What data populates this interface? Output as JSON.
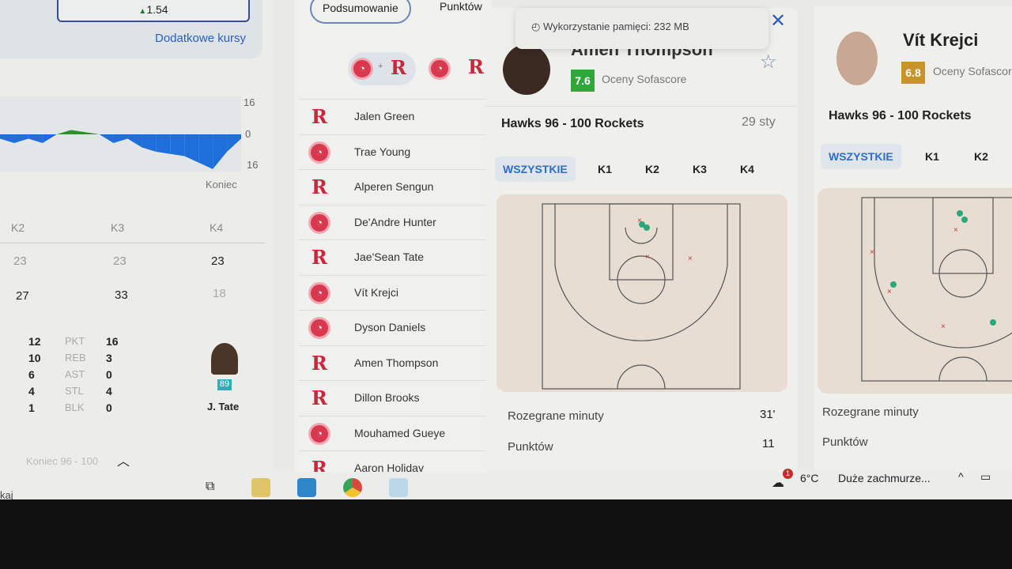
{
  "left": {
    "odds_value": "1.54",
    "more_odds": "Dodatkowe kursy",
    "chart_data": {
      "type": "area",
      "title": "",
      "y_ticks": [
        "16",
        "0",
        "16"
      ],
      "x_label_end": "Koniec",
      "ylim": [
        -16,
        16
      ],
      "values": [
        -2,
        -4,
        -2,
        -4,
        0,
        2,
        1,
        0,
        -4,
        -2,
        -6,
        -8,
        -9,
        -10,
        -13,
        -16,
        -8,
        -2
      ]
    },
    "quarters": {
      "headers": [
        "K2",
        "K3",
        "K4"
      ],
      "row1": [
        "23",
        "23",
        "23"
      ],
      "row2": [
        "27",
        "33",
        "18"
      ]
    },
    "stats": [
      {
        "l": "12",
        "label": "PKT",
        "r": "16"
      },
      {
        "l": "10",
        "label": "REB",
        "r": "3"
      },
      {
        "l": "6",
        "label": "AST",
        "r": "0"
      },
      {
        "l": "4",
        "label": "STL",
        "r": "4"
      },
      {
        "l": "1",
        "label": "BLK",
        "r": "0"
      }
    ],
    "player_name": "J. Tate",
    "jersey": "89",
    "footer": "Koniec 96 - 100",
    "search_fragment": "kaj"
  },
  "middle": {
    "tabs": [
      "Podsumowanie",
      "Punktów"
    ],
    "plus": "+",
    "players": [
      {
        "name": "Jalen Green",
        "team": "rockets"
      },
      {
        "name": "Trae Young",
        "team": "hawks"
      },
      {
        "name": "Alperen Sengun",
        "team": "rockets"
      },
      {
        "name": "De'Andre Hunter",
        "team": "hawks"
      },
      {
        "name": "Jae'Sean Tate",
        "team": "rockets"
      },
      {
        "name": "Vít Krejci",
        "team": "hawks"
      },
      {
        "name": "Dyson Daniels",
        "team": "hawks"
      },
      {
        "name": "Amen Thompson",
        "team": "rockets"
      },
      {
        "name": "Dillon Brooks",
        "team": "rockets"
      },
      {
        "name": "Mouhamed Gueye",
        "team": "hawks"
      },
      {
        "name": "Aaron Holiday",
        "team": "rockets"
      }
    ]
  },
  "memory_tip": "Wykorzystanie pamięci: 232 MB",
  "popup1": {
    "name": "Amen Thompson",
    "rating": "7.6",
    "rating_color": "#2fa83a",
    "rating_label": "Oceny Sofascore",
    "match": "Hawks 96 - 100 Rockets",
    "date": "29 sty",
    "tabs": [
      "WSZYSTKIE",
      "K1",
      "K2",
      "K3",
      "K4"
    ],
    "stats": [
      {
        "label": "Rozegrane minuty",
        "value": "31'"
      },
      {
        "label": "Punktów",
        "value": "11"
      }
    ]
  },
  "popup2": {
    "name": "Vít Krejci",
    "rating": "6.8",
    "rating_color": "#c8942a",
    "rating_label": "Oceny Sofascore",
    "match": "Hawks 96 - 100 Rockets",
    "tabs": [
      "WSZYSTKIE",
      "K1",
      "K2"
    ],
    "stats": [
      {
        "label": "Rozegrane minuty"
      },
      {
        "label": "Punktów"
      }
    ]
  },
  "taskbar": {
    "weather_temp": "6°C",
    "weather_text": "Duże zachmurze...",
    "weather_badge": "1"
  },
  "colors": {
    "accent": "#2d6ec8",
    "chart_neg": "#1e6fd9",
    "chart_pos": "#2b8f2b",
    "hawks": "#d9394f",
    "rockets": "#c8283c"
  }
}
